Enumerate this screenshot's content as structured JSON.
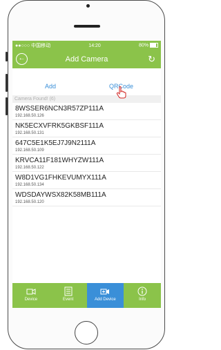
{
  "statusbar": {
    "carrier": "●●○○○ 中国移动",
    "time": "14:20",
    "battery": "80%"
  },
  "nav": {
    "title": "Add Camera",
    "back_glyph": "←",
    "refresh_glyph": "↻"
  },
  "segments": {
    "add": "Add",
    "qrcode": "QRCode"
  },
  "section_title": "Camera Found! (6)",
  "cameras": [
    {
      "id": "8WSSER6NCN3R57ZP111A",
      "ip": "192.168.50.126"
    },
    {
      "id": "NK5ECXVFRK5GKBSF111A",
      "ip": "192.168.50.131"
    },
    {
      "id": "647C5E1K5EJ7J9N2111A",
      "ip": "192.168.50.109"
    },
    {
      "id": "KRVCA11F181WHYZW111A",
      "ip": "192.168.50.122"
    },
    {
      "id": "W8D1VG1FHKEVUMYX111A",
      "ip": "192.168.50.134"
    },
    {
      "id": "WDSDAYWSX82K58MB111A",
      "ip": "192.168.50.120"
    }
  ],
  "tabs": [
    {
      "label": "Device",
      "icon": "camera-icon"
    },
    {
      "label": "Event",
      "icon": "list-icon"
    },
    {
      "label": "Add Device",
      "icon": "add-camera-icon"
    },
    {
      "label": "Info",
      "icon": "info-icon"
    }
  ],
  "colors": {
    "accent": "#8bc34a",
    "active_tab": "#3a8fd8",
    "link": "#3a8fd8"
  }
}
